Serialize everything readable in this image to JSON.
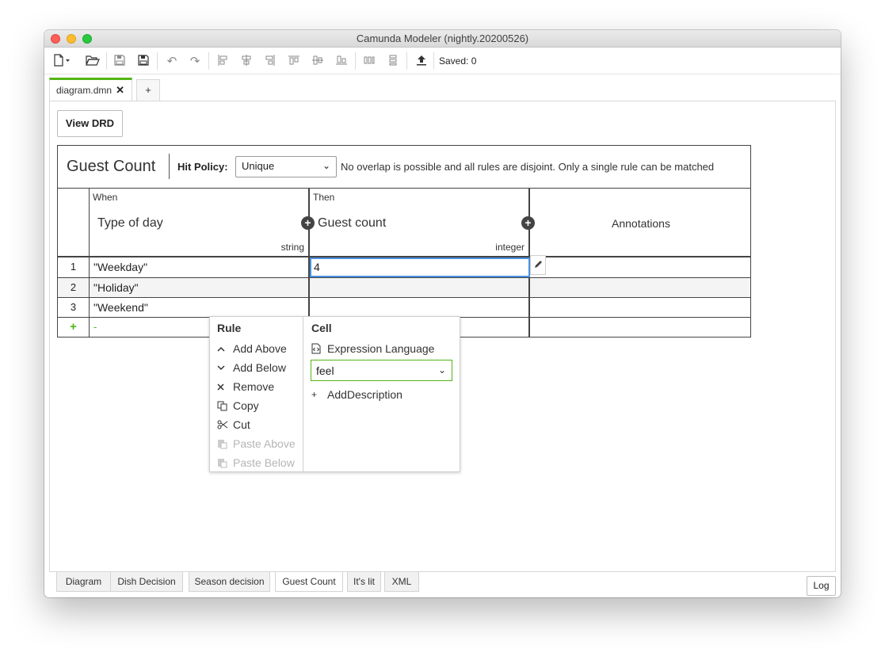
{
  "window": {
    "title": "Camunda Modeler (nightly.20200526)"
  },
  "toolbar": {
    "saved_label": "Saved: 0"
  },
  "file_tab": {
    "name": "diagram.dmn",
    "close": "✕",
    "add": "+"
  },
  "view_drd_label": "View DRD",
  "decision": {
    "name": "Guest Count",
    "hit_policy_label": "Hit Policy:",
    "hit_policy_value": "Unique",
    "hit_policy_description": "No overlap is possible and all rules are disjoint. Only a single rule can be matched"
  },
  "table": {
    "input": {
      "section": "When",
      "label": "Type of day",
      "type": "string"
    },
    "output": {
      "section": "Then",
      "label": "Guest count",
      "type": "integer"
    },
    "annotations_label": "Annotations",
    "rows": [
      {
        "index": "1",
        "input": "\"Weekday\"",
        "output": "4"
      },
      {
        "index": "2",
        "input": "\"Holiday\"",
        "output": ""
      },
      {
        "index": "3",
        "input": "\"Weekend\"",
        "output": ""
      }
    ],
    "add_row": {
      "plus": "+",
      "dash": "-"
    }
  },
  "context_menu": {
    "rule_title": "Rule",
    "rule_items": [
      {
        "label": "Add Above",
        "icon": "chevron-up-icon",
        "enabled": true
      },
      {
        "label": "Add Below",
        "icon": "chevron-down-icon",
        "enabled": true
      },
      {
        "label": "Remove",
        "icon": "close-icon",
        "enabled": true
      },
      {
        "label": "Copy",
        "icon": "copy-icon",
        "enabled": true
      },
      {
        "label": "Cut",
        "icon": "scissors-icon",
        "enabled": true
      },
      {
        "label": "Paste Above",
        "icon": "paste-icon",
        "enabled": false
      },
      {
        "label": "Paste Below",
        "icon": "paste-icon",
        "enabled": false
      }
    ],
    "cell_title": "Cell",
    "expression_language_label": "Expression Language",
    "expression_language_value": "feel",
    "add_description_label": "AddDescription",
    "add_description_icon": "+"
  },
  "bottom_tabs": [
    "Diagram",
    "Dish Decision",
    "Season decision",
    "Guest Count",
    "It's lit",
    "XML"
  ],
  "active_bottom_tab": "Guest Count",
  "log_label": "Log",
  "colors": {
    "accent_green": "#52b415",
    "selection_blue": "#4a90e2"
  }
}
